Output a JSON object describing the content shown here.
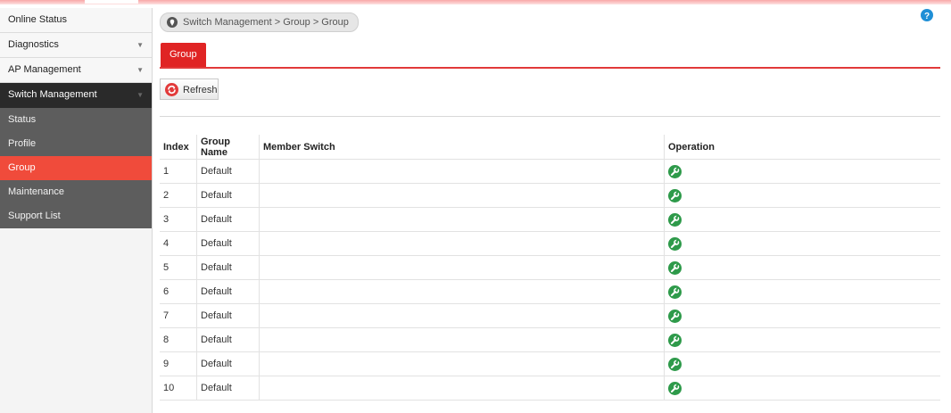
{
  "sidebar": {
    "items": [
      {
        "label": "Online Status",
        "has_caret": false
      },
      {
        "label": "Diagnostics",
        "has_caret": true
      },
      {
        "label": "AP Management",
        "has_caret": true
      },
      {
        "label": "Switch Management",
        "has_caret": true
      }
    ],
    "submenu": [
      {
        "label": "Status"
      },
      {
        "label": "Profile"
      },
      {
        "label": "Group"
      },
      {
        "label": "Maintenance"
      },
      {
        "label": "Support List"
      }
    ],
    "selected": "Group"
  },
  "breadcrumb": "Switch Management  > Group  > Group",
  "tab": {
    "label": "Group"
  },
  "refresh_label": "Refresh",
  "table": {
    "headers": [
      "Index",
      "Group Name",
      "Member Switch",
      "Operation"
    ],
    "rows": [
      {
        "index": "1",
        "group_name": "Default",
        "member_switch": ""
      },
      {
        "index": "2",
        "group_name": "Default",
        "member_switch": ""
      },
      {
        "index": "3",
        "group_name": "Default",
        "member_switch": ""
      },
      {
        "index": "4",
        "group_name": "Default",
        "member_switch": ""
      },
      {
        "index": "5",
        "group_name": "Default",
        "member_switch": ""
      },
      {
        "index": "6",
        "group_name": "Default",
        "member_switch": ""
      },
      {
        "index": "7",
        "group_name": "Default",
        "member_switch": ""
      },
      {
        "index": "8",
        "group_name": "Default",
        "member_switch": ""
      },
      {
        "index": "9",
        "group_name": "Default",
        "member_switch": ""
      },
      {
        "index": "10",
        "group_name": "Default",
        "member_switch": ""
      }
    ]
  },
  "icons": {
    "breadcrumb": "location-pin-icon",
    "help": "help-icon",
    "refresh": "refresh-icon",
    "operation": "wrench-icon",
    "caret": "caret-down-icon"
  },
  "colors": {
    "accent_red": "#e02424",
    "selected_item": "#f04b3b",
    "operation_green": "#2e9a4a",
    "help_blue": "#1f8fd6"
  }
}
